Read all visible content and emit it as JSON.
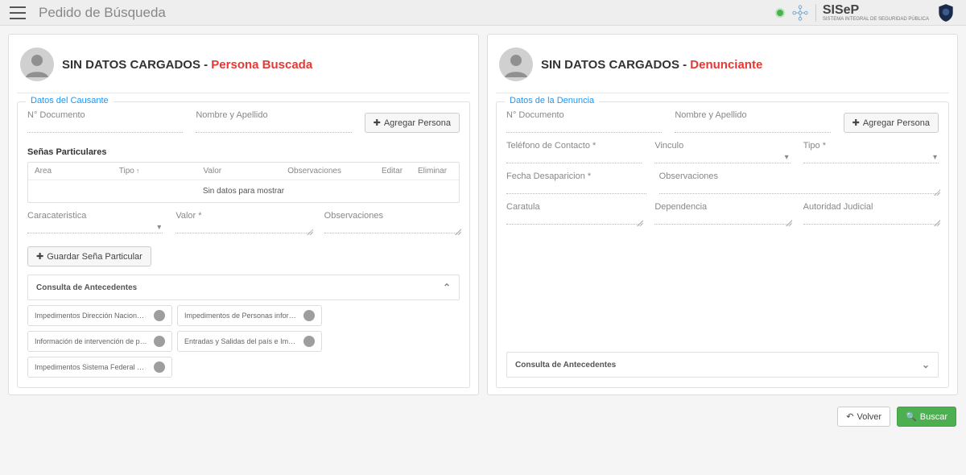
{
  "header": {
    "title": "Pedido de Búsqueda",
    "brand": "SISeP",
    "brand_sub": "SISTEMA INTEGRAL DE SEGURIDAD PÚBLICA"
  },
  "left": {
    "title_prefix": "SIN DATOS CARGADOS - ",
    "title_highlight": "Persona Buscada",
    "fieldset_legend": "Datos del Causante",
    "doc_label": "N° Documento",
    "name_label": "Nombre y Apellido",
    "add_person_btn": "Agregar Persona",
    "senas_label": "Señas Particulares",
    "table": {
      "cols": [
        "Area",
        "Tipo",
        "Valor",
        "Observaciones",
        "Editar",
        "Eliminar"
      ],
      "empty": "Sin datos para mostrar"
    },
    "caracteristica_label": "Caracateristica",
    "valor_label": "Valor *",
    "obs_label": "Observaciones",
    "save_sena_btn": "Guardar Seña Particular",
    "consulta_label": "Consulta de Antecedentes",
    "chips": [
      "Impedimentos Dirección Nacional de Reinc...",
      "Impedimentos de Personas informadas por...",
      "Información de intervención de personas e...",
      "Entradas y Salidas del país e Impedimento...",
      "Impedimentos Sistema Federal de Consult..."
    ]
  },
  "right": {
    "title_prefix": "SIN DATOS CARGADOS - ",
    "title_highlight": "Denunciante",
    "fieldset_legend": "Datos de la Denuncia",
    "doc_label": "N° Documento",
    "name_label": "Nombre y Apellido",
    "add_person_btn": "Agregar Persona",
    "telefono_label": "Teléfono de Contacto *",
    "vinculo_label": "Vinculo",
    "tipo_label": "Tipo *",
    "fecha_label": "Fecha Desaparicion *",
    "obs_label": "Observaciones",
    "caratula_label": "Caratula",
    "dependencia_label": "Dependencia",
    "autoridad_label": "Autoridad Judicial",
    "consulta_label": "Consulta de Antecedentes"
  },
  "footer": {
    "volver": "Volver",
    "buscar": "Buscar"
  }
}
